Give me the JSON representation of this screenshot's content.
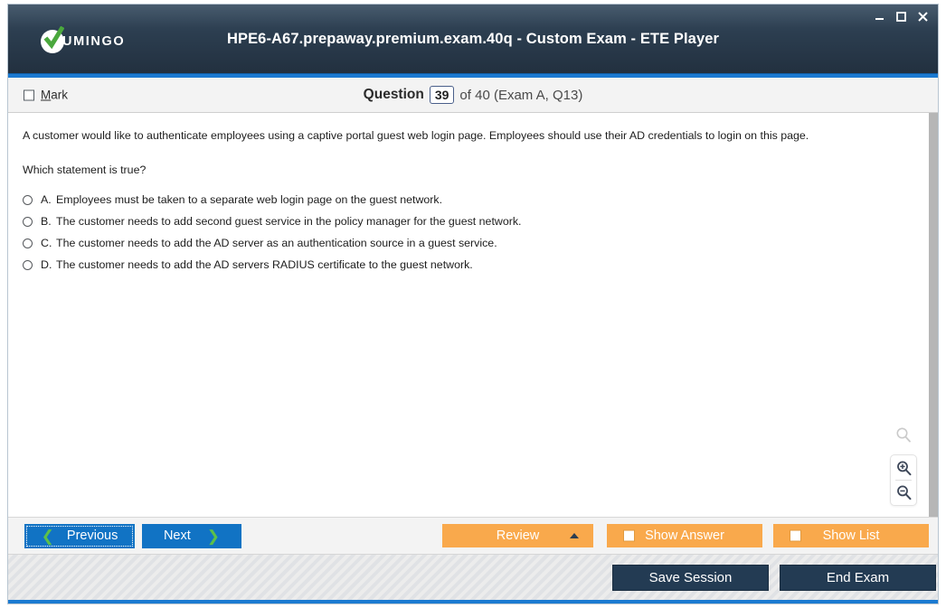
{
  "window": {
    "title": "HPE6-A67.prepaway.premium.exam.40q - Custom Exam - ETE Player",
    "logo_text": "UMINGO",
    "controls": {
      "minimize": "minimize-icon",
      "maximize": "maximize-icon",
      "close": "close-icon"
    }
  },
  "question_header": {
    "mark_label_accel": "M",
    "mark_label_rest": "ark",
    "question_word": "Question",
    "question_number": "39",
    "of_text": "of 40 (Exam A, Q13)"
  },
  "question": {
    "body": "A customer would like to authenticate employees using a captive portal guest web login page. Employees should use their AD credentials to login on this page.",
    "prompt": "Which statement is true?",
    "options": [
      {
        "letter": "A.",
        "text": "Employees must be taken to a separate web login page on the guest network."
      },
      {
        "letter": "B.",
        "text": "The customer needs to add second guest service in the policy manager for the guest network."
      },
      {
        "letter": "C.",
        "text": "The customer needs to add the AD server as an authentication source in a guest service."
      },
      {
        "letter": "D.",
        "text": "The customer needs to add the AD servers RADIUS certificate to the guest network."
      }
    ]
  },
  "zoom_tools": {
    "search": "magnifier-icon",
    "zoom_in": "zoom-in-icon",
    "zoom_out": "zoom-out-icon"
  },
  "toolbar": {
    "previous_label": "Previous",
    "next_label": "Next",
    "review_label": "Review",
    "show_answer_label": "Show Answer",
    "show_list_label": "Show List",
    "save_session_label": "Save Session",
    "end_exam_label": "End Exam"
  },
  "colors": {
    "titlebar": "#2c3e50",
    "accent_blue": "#1b7ad1",
    "button_blue": "#1173c4",
    "button_orange": "#f9a94c",
    "button_dark": "#233b53",
    "chevron_green": "#5cc04a"
  }
}
